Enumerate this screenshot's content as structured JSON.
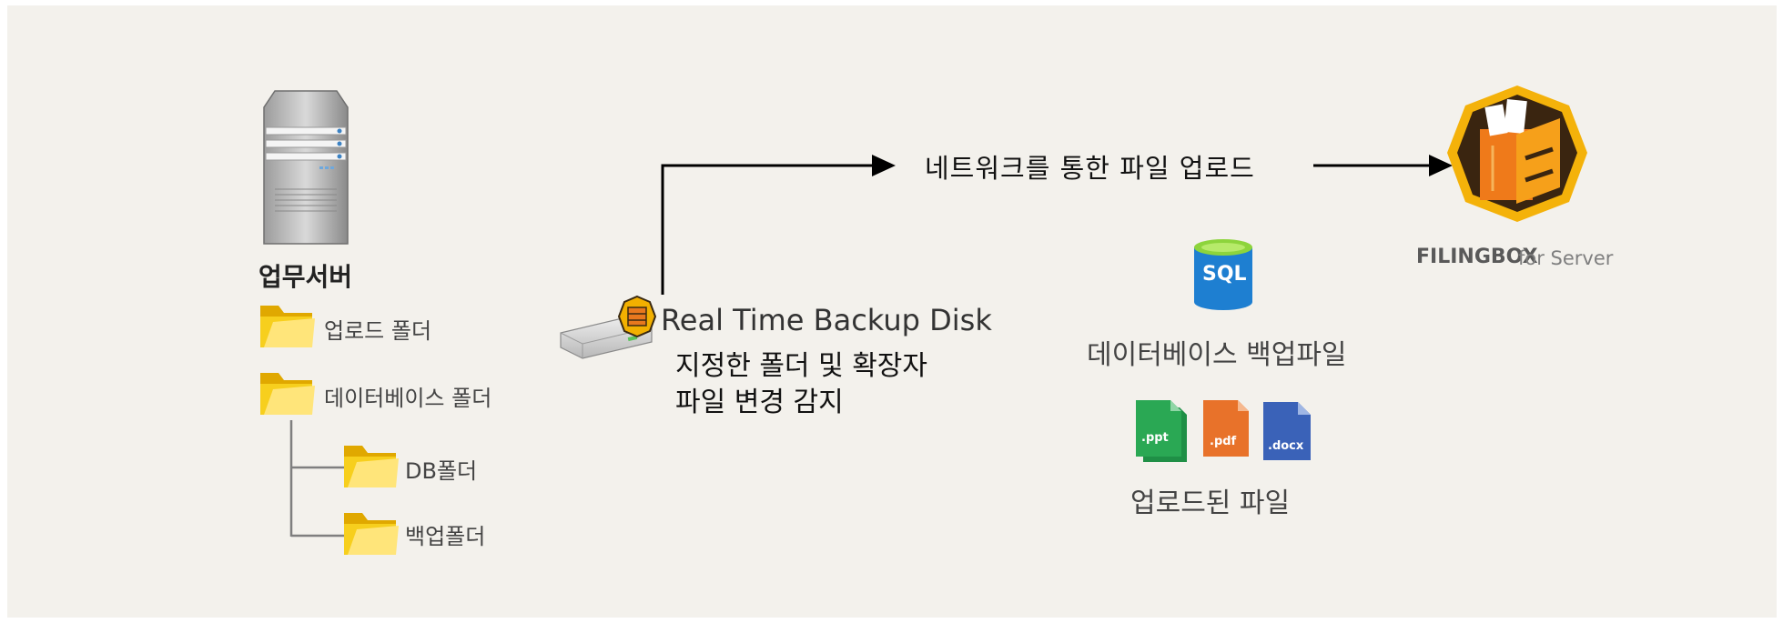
{
  "server": {
    "label": "업무서버"
  },
  "folders": [
    {
      "label": "업로드 폴더"
    },
    {
      "label": "데이터베이스 폴더"
    },
    {
      "label": "DB폴더"
    },
    {
      "label": "백업폴더"
    }
  ],
  "disk": {
    "label": "Real Time Backup Disk",
    "detect_text": "지정한 폴더 및 확장자\n파일 변경 감지"
  },
  "network": {
    "label": "네트워크를 통한 파일 업로드"
  },
  "sql": {
    "icon_text": "SQL",
    "label": "데이터베이스 백업파일"
  },
  "files": [
    {
      "ext": ".ppt",
      "color": "#2aa854"
    },
    {
      "ext": ".pdf",
      "color": "#e8722a"
    },
    {
      "ext": ".docx",
      "color": "#3a62b8"
    }
  ],
  "uploaded": {
    "label": "업로드된 파일"
  },
  "brand": {
    "name": "FILINGBOX",
    "suffix": "for Server"
  },
  "colors": {
    "background": "#f3f1ec",
    "folder": "#f5c400",
    "sql": "#1e7fd1",
    "logo": "#f4b20a"
  }
}
